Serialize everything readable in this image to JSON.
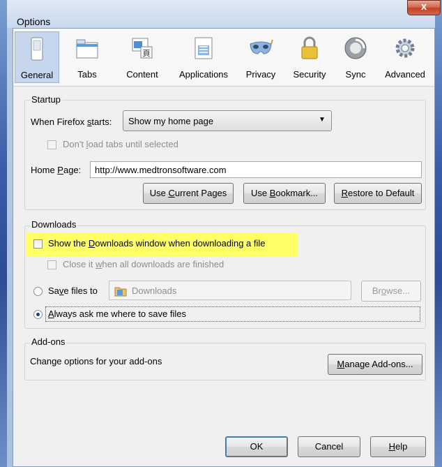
{
  "window": {
    "title": "Options",
    "close_glyph": "x"
  },
  "panes": [
    {
      "label": "General",
      "icon": "general-icon",
      "selected": true
    },
    {
      "label": "Tabs",
      "icon": "tabs-icon"
    },
    {
      "label": "Content",
      "icon": "content-icon"
    },
    {
      "label": "Applications",
      "icon": "applications-icon"
    },
    {
      "label": "Privacy",
      "icon": "privacy-mask-icon"
    },
    {
      "label": "Security",
      "icon": "security-lock-icon"
    },
    {
      "label": "Sync",
      "icon": "sync-icon"
    },
    {
      "label": "Advanced",
      "icon": "advanced-gear-icon"
    }
  ],
  "startup": {
    "legend": "Startup",
    "when_label": "When Firefox starts:",
    "when_value": "Show my home page",
    "dont_load_tabs": "Don't load tabs until selected",
    "home_page_label": "Home Page:",
    "home_page_value": "http://www.medtronsoftware.com",
    "use_current": "Use Current Pages",
    "use_bookmark": "Use Bookmark...",
    "restore_default": "Restore to Default"
  },
  "downloads": {
    "legend": "Downloads",
    "show_window": "Show the Downloads window when downloading a file",
    "close_it": "Close it when all downloads are finished",
    "save_files_label": "Save files to",
    "save_folder": "Downloads",
    "browse": "Browse...",
    "always_ask": "Always ask me where to save files",
    "highlight_color": "#ffff66"
  },
  "addons": {
    "legend": "Add-ons",
    "description": "Change options for your add-ons",
    "manage": "Manage Add-ons..."
  },
  "footer": {
    "ok": "OK",
    "cancel": "Cancel",
    "help": "Help"
  }
}
